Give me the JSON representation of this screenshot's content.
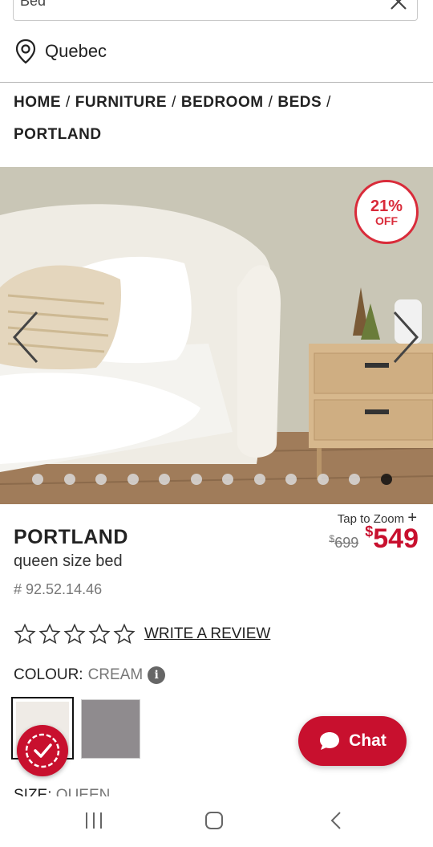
{
  "search": {
    "query": "Bed"
  },
  "location": {
    "label": "Quebec"
  },
  "breadcrumb": {
    "items": [
      "HOME",
      "FURNITURE",
      "BEDROOM",
      "BEDS",
      "PORTLAND"
    ],
    "separator": "/"
  },
  "gallery": {
    "badge_percent": "21%",
    "badge_label": "OFF",
    "dot_count": 12,
    "active_dot": 12
  },
  "product": {
    "tap_to_zoom": "Tap to Zoom",
    "name": "PORTLAND",
    "subtitle": "queen size bed",
    "sku": "# 92.52.14.46",
    "old_price_symbol": "$",
    "old_price": "699",
    "new_price_symbol": "$",
    "new_price": "549",
    "write_review": "WRITE A REVIEW",
    "rating": 0,
    "colour_label": "COLOUR:",
    "colour_value": "CREAM",
    "size_label": "SIZE:",
    "size_value": "QUEEN"
  },
  "swatches": [
    {
      "name": "Cream",
      "color": "#efebe6"
    },
    {
      "name": "Grey",
      "color": "#8f8b8e"
    }
  ],
  "chat": {
    "label": "Chat"
  },
  "colors": {
    "brand_red": "#c8102e",
    "badge_red": "#d92b3a"
  }
}
